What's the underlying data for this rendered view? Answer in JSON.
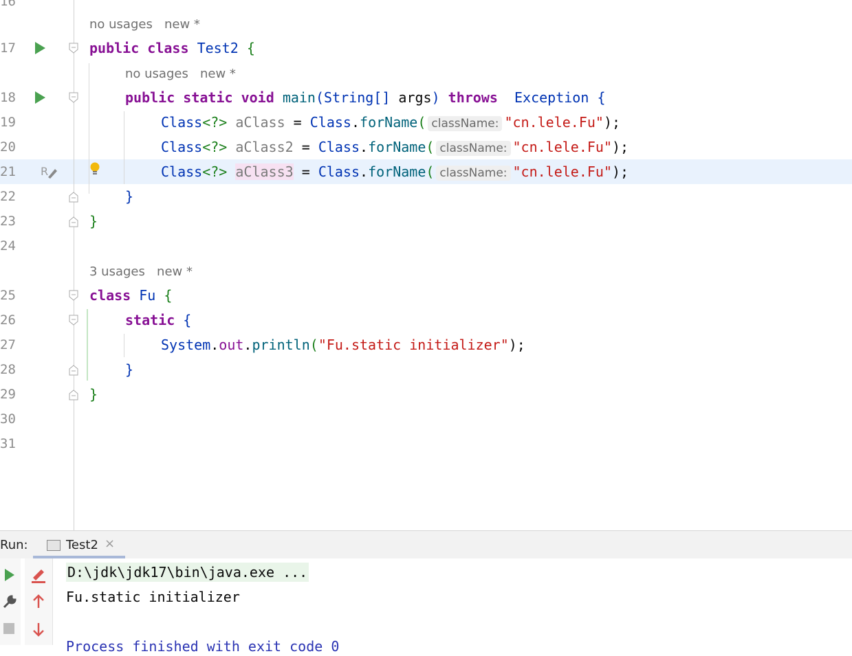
{
  "editor": {
    "hints": {
      "class_test2": "no usages   new *",
      "main_method": "no usages   new *",
      "class_fu": "3 usages   new *"
    },
    "line_numbers": [
      "16",
      "17",
      "18",
      "19",
      "20",
      "21",
      "22",
      "23",
      "24",
      "25",
      "26",
      "27",
      "28",
      "29",
      "30",
      "31"
    ],
    "code": {
      "l17": {
        "kw1": "public",
        "kw2": "class",
        "name": "Test2",
        "brace": "{"
      },
      "l18": {
        "kw1": "public",
        "kw2": "static",
        "kw3": "void",
        "fn": "main",
        "p_open": "(",
        "type": "String[]",
        "arg": "args",
        "p_close": ")",
        "throws": "throws",
        "exc": "Exception",
        "brace": "{"
      },
      "l19": {
        "type": "Class",
        "gen": "<?>",
        "var": "aClass",
        "eq": " = ",
        "cls": "Class",
        "dot": ".",
        "fn": "forName",
        "po": "(",
        "hint": "className:",
        "str": "\"cn.lele.Fu\"",
        "end": ");"
      },
      "l20": {
        "type": "Class",
        "gen": "<?>",
        "var": "aClass2",
        "eq": " = ",
        "cls": "Class",
        "dot": ".",
        "fn": "forName",
        "po": "(",
        "hint": "className:",
        "str": "\"cn.lele.Fu\"",
        "end": ");"
      },
      "l21": {
        "type": "Class",
        "gen": "<?>",
        "var": "aClass3",
        "eq": " = ",
        "cls": "Class",
        "dot": ".",
        "fn": "forName",
        "po": "(",
        "hint": "className:",
        "str": "\"cn.lele.Fu\"",
        "end": ");"
      },
      "l22": {
        "brace": "}"
      },
      "l23": {
        "brace": "}"
      },
      "l25": {
        "kw": "class",
        "name": "Fu",
        "brace": "{"
      },
      "l26": {
        "kw": "static",
        "brace": "{"
      },
      "l27": {
        "sys": "System",
        "dot1": ".",
        "out": "out",
        "dot2": ".",
        "fn": "println",
        "po": "(",
        "str": "\"Fu.static initializer\"",
        "end": ");"
      },
      "l28": {
        "brace": "}"
      },
      "l29": {
        "brace": "}"
      }
    }
  },
  "run_panel": {
    "label": "Run:",
    "tab_title": "Test2",
    "tab_close": "×",
    "output": [
      "D:\\jdk\\jdk17\\bin\\java.exe ...",
      "Fu.static initializer",
      "",
      "Process finished with exit code 0"
    ]
  },
  "colors": {
    "keyword": "#871094",
    "string": "#c41a16",
    "function": "#00627a",
    "class": "#0033b3",
    "run_green": "#4aa150",
    "highlight_line": "#e9f2fd"
  }
}
